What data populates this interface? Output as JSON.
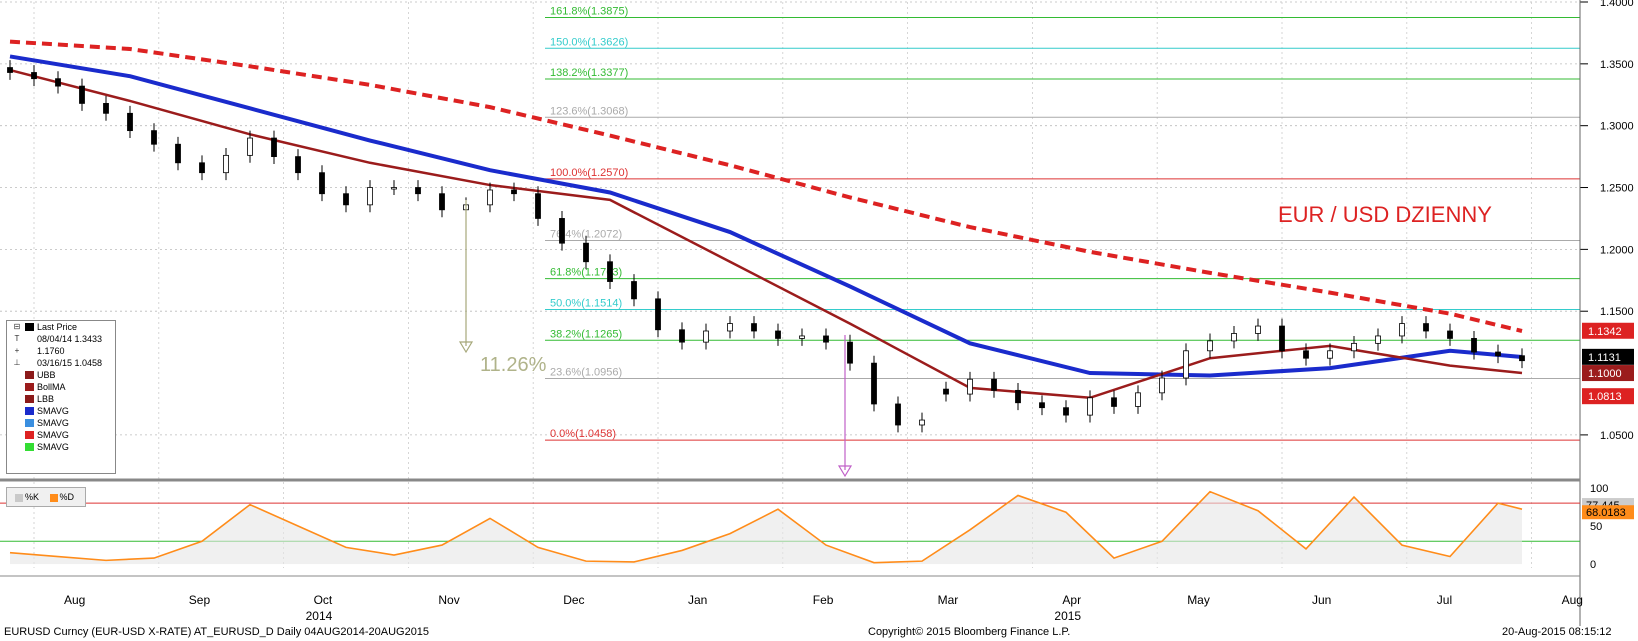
{
  "chart_data": [
    {
      "type": "candlestick",
      "title": "EUR / USD DZIENNY",
      "ylim": [
        1.02,
        1.4
      ],
      "y_ticks": [
        "1.4000",
        "1.3500",
        "1.3000",
        "1.2500",
        "1.2000",
        "1.1500",
        "1.0500"
      ],
      "x_ticks": [
        "Aug",
        "Sep",
        "Oct",
        "Nov",
        "Dec",
        "Jan",
        "Feb",
        "Mar",
        "Apr",
        "May",
        "Jun",
        "Jul",
        "Aug"
      ],
      "year_labels": [
        "2014",
        "2015"
      ],
      "fibonacci": [
        {
          "label": "161.8%(1.3875)",
          "value": 1.3875,
          "color": "#33bb33"
        },
        {
          "label": "150.0%(1.3626)",
          "value": 1.3626,
          "color": "#33cccc"
        },
        {
          "label": "138.2%(1.3377)",
          "value": 1.3377,
          "color": "#33bb33"
        },
        {
          "label": "123.6%(1.3068)",
          "value": 1.3068,
          "color": "#aaaaaa"
        },
        {
          "label": "100.0%(1.2570)",
          "value": 1.257,
          "color": "#dd3333"
        },
        {
          "label": "76.4%(1.2072)",
          "value": 1.2072,
          "color": "#aaaaaa"
        },
        {
          "label": "61.8%(1.1763)",
          "value": 1.1763,
          "color": "#33bb33"
        },
        {
          "label": "50.0%(1.1514)",
          "value": 1.1514,
          "color": "#33cccc"
        },
        {
          "label": "38.2%(1.1265)",
          "value": 1.1265,
          "color": "#33bb33"
        },
        {
          "label": "23.6%(1.0956)",
          "value": 1.0956,
          "color": "#aaaaaa"
        },
        {
          "label": "0.0%(1.0458)",
          "value": 1.0458,
          "color": "#dd3333"
        }
      ],
      "price_tags": [
        {
          "label": "1.1342",
          "value": 1.1342,
          "color": "#dd2222"
        },
        {
          "label": "1.1131",
          "value": 1.1131,
          "color": "#000000"
        },
        {
          "label": "1.1000",
          "value": 1.1,
          "color": "#9b1c1c"
        },
        {
          "label": "1.0813",
          "value": 1.0813,
          "color": "#dd2222"
        }
      ],
      "annotation": "11.26%",
      "legend": [
        {
          "sign": "⊟",
          "name": "Last Price",
          "color": "#000000"
        },
        {
          "sign": "T",
          "name": "08/04/14 1.3433",
          "color": ""
        },
        {
          "sign": "+",
          "name": "1.1760",
          "color": ""
        },
        {
          "sign": "⊥",
          "name": "03/16/15 1.0458",
          "color": ""
        },
        {
          "sign": "",
          "name": "UBB",
          "color": "#8b1a1a"
        },
        {
          "sign": "",
          "name": "BollMA",
          "color": "#9b1c1c"
        },
        {
          "sign": "",
          "name": "LBB",
          "color": "#8b1a1a"
        },
        {
          "sign": "",
          "name": "SMAVG",
          "color": "#1a2bcc"
        },
        {
          "sign": "",
          "name": "SMAVG",
          "color": "#3a8fe0"
        },
        {
          "sign": "",
          "name": "SMAVG",
          "color": "#dd2222"
        },
        {
          "sign": "",
          "name": "SMAVG",
          "color": "#33dd33"
        }
      ],
      "series": [
        {
          "name": "Last Price",
          "kind": "candle",
          "color": "#000000",
          "x": [
            0,
            10,
            20,
            30,
            40,
            50,
            60,
            70,
            80,
            90,
            100,
            110,
            120,
            130,
            140,
            150,
            160,
            170,
            180,
            190,
            200,
            210,
            220,
            230,
            240,
            250,
            260,
            270,
            280,
            290,
            300,
            310,
            320,
            330,
            340,
            350,
            360,
            370,
            380
          ],
          "y": [
            1.343,
            1.338,
            1.332,
            1.318,
            1.31,
            1.296,
            1.285,
            1.27,
            1.262,
            1.276,
            1.29,
            1.275,
            1.262,
            1.245,
            1.236,
            1.25,
            1.25,
            1.245,
            1.232,
            1.236,
            1.248,
            1.245,
            1.225,
            1.205,
            1.19,
            1.174,
            1.16,
            1.135,
            1.125,
            1.134,
            1.14,
            1.134,
            1.128,
            1.13,
            1.125,
            1.108,
            1.075,
            1.058,
            1.062
          ]
        },
        {
          "name": "Last Price (cont.)",
          "kind": "candle",
          "color": "#000000",
          "x": [
            390,
            400,
            410,
            420,
            430,
            440,
            450,
            460,
            470,
            480,
            490,
            500,
            510,
            520,
            530,
            540,
            550,
            560,
            570,
            580,
            590,
            600,
            610,
            620,
            630
          ],
          "y": [
            1.083,
            1.095,
            1.086,
            1.076,
            1.072,
            1.066,
            1.08,
            1.073,
            1.084,
            1.096,
            1.118,
            1.126,
            1.132,
            1.138,
            1.118,
            1.112,
            1.118,
            1.124,
            1.13,
            1.14,
            1.134,
            1.128,
            1.117,
            1.114,
            1.11
          ]
        }
      ],
      "overlays": [
        {
          "name": "SMAVG 200",
          "color": "#dd2222",
          "x": [
            0,
            50,
            100,
            150,
            200,
            250,
            300,
            350,
            400,
            450,
            500,
            550,
            600,
            630
          ],
          "y": [
            1.368,
            1.362,
            1.348,
            1.333,
            1.315,
            1.292,
            1.268,
            1.242,
            1.218,
            1.198,
            1.181,
            1.165,
            1.148,
            1.134
          ]
        },
        {
          "name": "SMAVG 100",
          "color": "#1a2bcc",
          "x": [
            0,
            50,
            100,
            150,
            200,
            250,
            300,
            350,
            400,
            450,
            500,
            550,
            600,
            630
          ],
          "y": [
            1.356,
            1.34,
            1.314,
            1.288,
            1.264,
            1.246,
            1.214,
            1.17,
            1.124,
            1.1,
            1.098,
            1.104,
            1.118,
            1.113
          ]
        },
        {
          "name": "BollMA",
          "color": "#9b1c1c",
          "x": [
            0,
            50,
            100,
            150,
            200,
            250,
            300,
            350,
            400,
            450,
            500,
            550,
            600,
            630
          ],
          "y": [
            1.345,
            1.32,
            1.293,
            1.27,
            1.252,
            1.24,
            1.19,
            1.14,
            1.088,
            1.08,
            1.112,
            1.122,
            1.106,
            1.1
          ]
        }
      ]
    },
    {
      "type": "line",
      "title": "",
      "ylim": [
        -5,
        105
      ],
      "y_ticks": [
        "100",
        "50",
        "0"
      ],
      "last_values": [
        {
          "label": "77.445",
          "color": "#cccccc",
          "value": 77.445
        },
        {
          "label": "68.0183",
          "color": "#ff8c1a",
          "value": 68.0183
        }
      ],
      "legend": [
        {
          "name": "%K",
          "color": "#c9c9c9"
        },
        {
          "name": "%D",
          "color": "#ff8c1a"
        }
      ],
      "reference_lines": [
        {
          "value": 80,
          "color": "#dd3333"
        },
        {
          "value": 30,
          "color": "#33bb33"
        }
      ],
      "series": [
        {
          "name": "%D",
          "color": "#ff8c1a",
          "x": [
            0,
            20,
            40,
            60,
            80,
            100,
            120,
            140,
            160,
            180,
            200,
            220,
            240,
            260,
            280,
            300,
            320,
            340,
            360,
            380,
            400,
            420,
            440,
            460,
            480,
            500,
            520,
            540,
            560,
            580,
            600,
            620,
            630
          ],
          "y": [
            15,
            10,
            5,
            8,
            30,
            78,
            50,
            22,
            12,
            25,
            60,
            22,
            4,
            3,
            18,
            40,
            72,
            25,
            2,
            4,
            45,
            90,
            68,
            8,
            30,
            95,
            70,
            20,
            88,
            25,
            10,
            80,
            72
          ]
        }
      ]
    }
  ],
  "footer": {
    "left": "EURUSD Curncy (EUR-USD X-RATE) AT_EURUSD_D  Daily 04AUG2014-20AUG2015",
    "center": "Copyright© 2015 Bloomberg Finance L.P.",
    "right": "20-Aug-2015 08:15:12"
  }
}
